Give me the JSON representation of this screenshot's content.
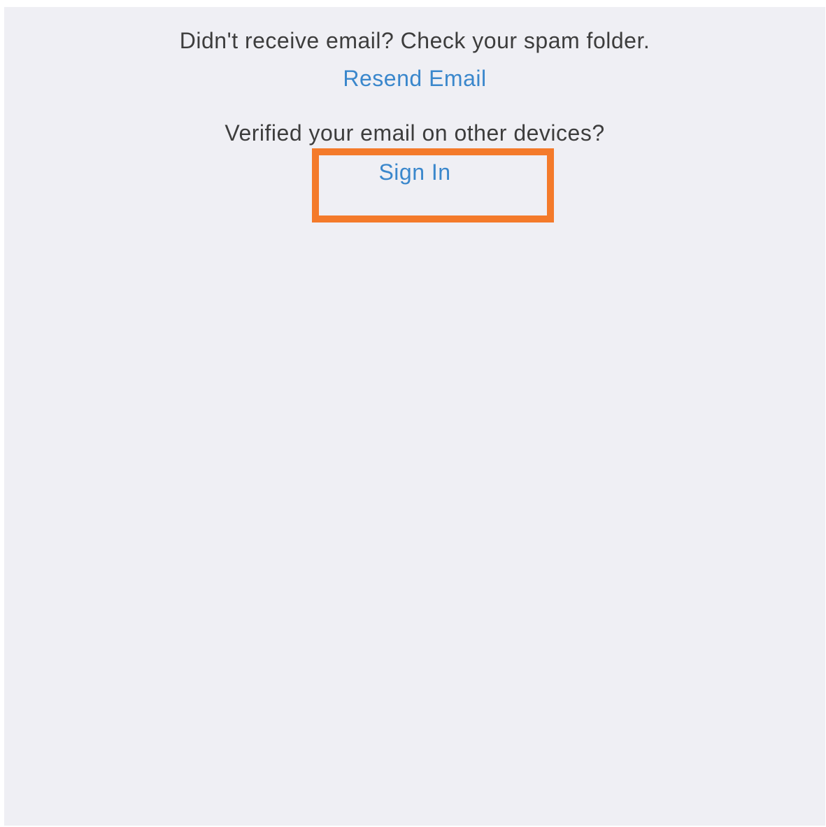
{
  "email_verification": {
    "spam_prompt": "Didn't receive email? Check your spam folder.",
    "resend_label": "Resend Email",
    "verified_prompt": "Verified your email on other devices?",
    "sign_in_label": "Sign In"
  },
  "colors": {
    "background": "#efeff4",
    "prompt_text": "#3d3d3d",
    "link": "#3a87cc",
    "highlight": "#f47a2a"
  }
}
